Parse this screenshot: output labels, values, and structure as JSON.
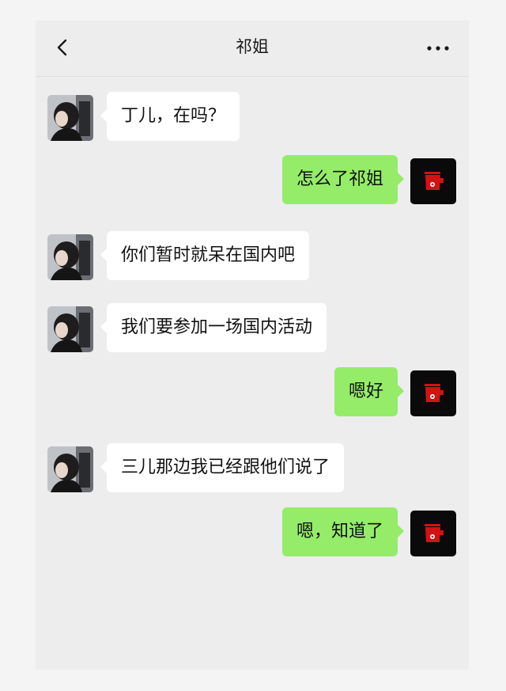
{
  "header": {
    "title": "祁姐",
    "back_icon": "chevron-left-icon",
    "more_icon": "more-horizontal-icon"
  },
  "colors": {
    "screen_bg": "#ededed",
    "received_bubble": "#ffffff",
    "sent_bubble": "#95ec69"
  },
  "messages": [
    {
      "side": "left",
      "text": "丁儿，在吗？"
    },
    {
      "side": "right",
      "text": "怎么了祁姐"
    },
    {
      "side": "left",
      "text": "你们暂时就呆在国内吧"
    },
    {
      "side": "left",
      "text": "我们要参加一场国内活动"
    },
    {
      "side": "right",
      "text": "嗯好"
    },
    {
      "side": "left",
      "text": "三儿那边我已经跟他们说了"
    },
    {
      "side": "right",
      "text": "嗯，知道了"
    }
  ]
}
